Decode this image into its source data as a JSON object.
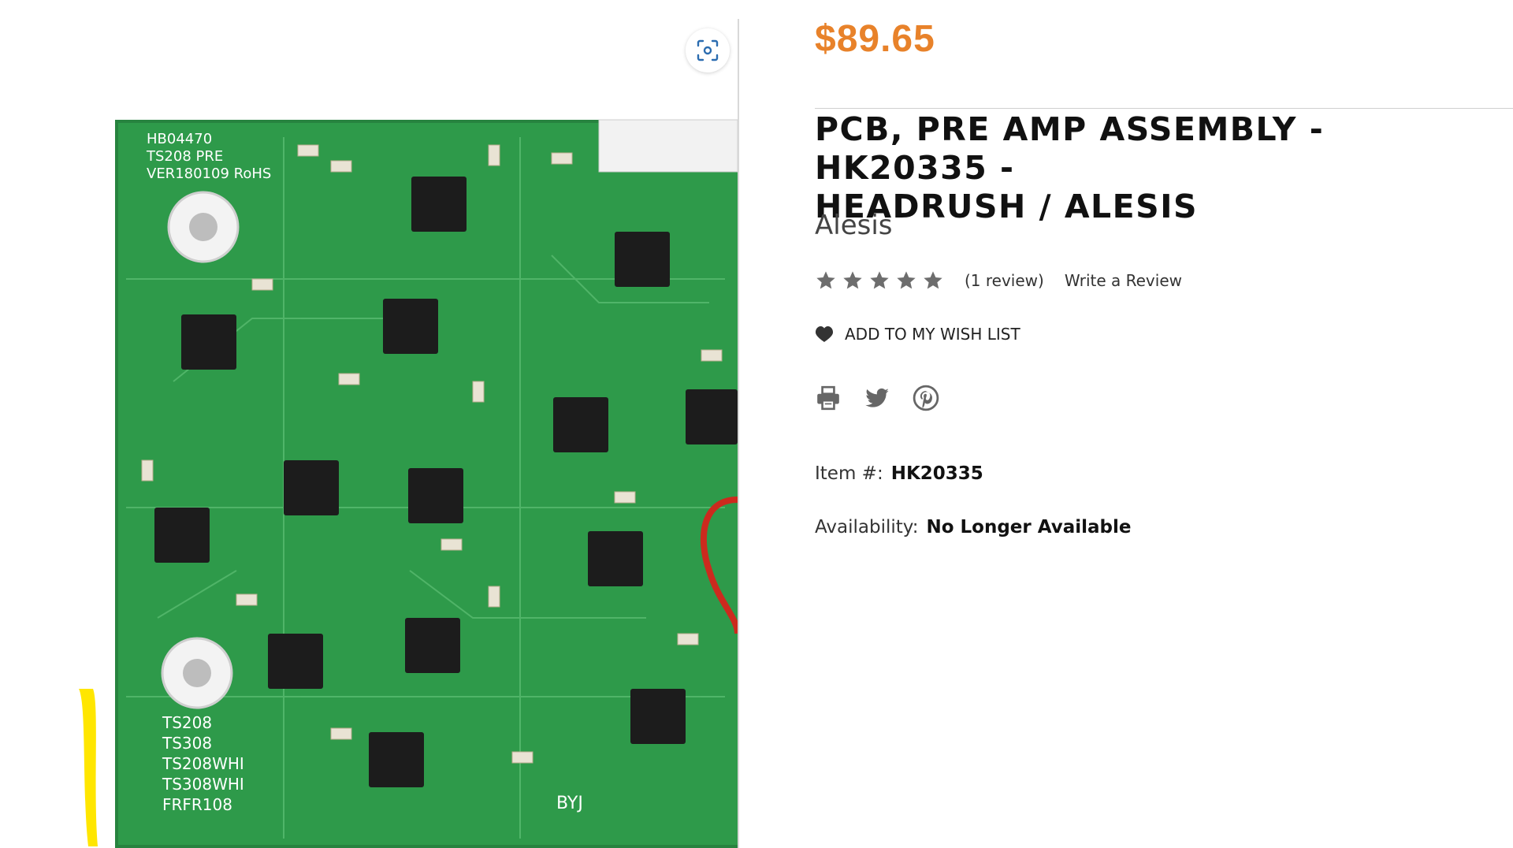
{
  "product": {
    "price": "$89.65",
    "title_line1": "PCB, PRE AMP ASSEMBLY - HK20335 -",
    "title_line2": "HEADRUSH / ALESIS",
    "brand": "Alesis",
    "rating": {
      "stars": 5,
      "review_count": "(1 review)",
      "write_review": "Write a Review"
    },
    "wishlist_label": "ADD TO MY WISH LIST",
    "item_label": "Item #:",
    "item_number": "HK20335",
    "availability_label": "Availability:",
    "availability_value": "No Longer Available"
  },
  "image": {
    "silkscreen": [
      "HB04470",
      "TS208 PRE",
      "VER180109  RoHS"
    ],
    "variant_labels": [
      "TS208",
      "TS308",
      "TS208WHI",
      "TS308WHI",
      "FRFR108"
    ],
    "board_mark": "BYJ"
  },
  "icons": {
    "zoom": "zoom-scan-icon",
    "heart": "heart-icon",
    "print": "print-icon",
    "twitter": "twitter-icon",
    "pinterest": "pinterest-icon",
    "star": "star-icon"
  },
  "colors": {
    "price": "#e8822a",
    "star": "#6d6d6d",
    "pcb_green": "#2e9a4a",
    "chip": "#1c1c1c",
    "highlight_marker": "#ffe600"
  }
}
